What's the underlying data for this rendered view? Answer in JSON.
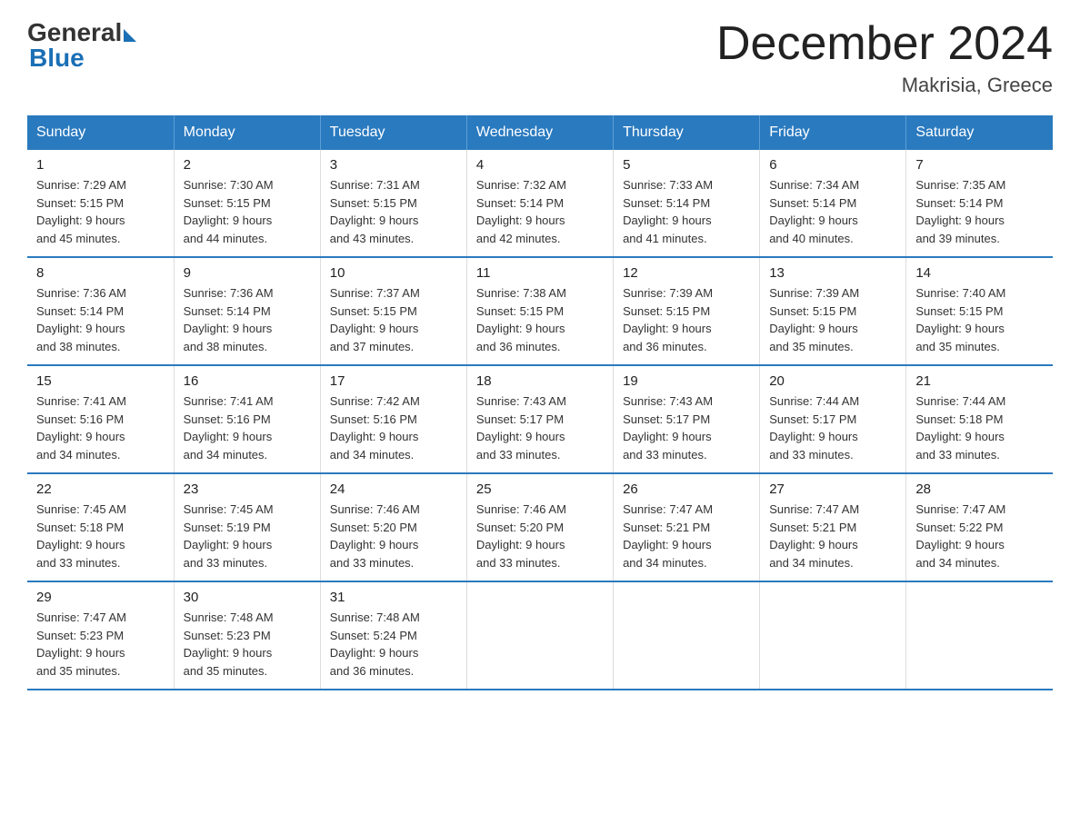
{
  "logo": {
    "general": "General",
    "blue": "Blue"
  },
  "title": "December 2024",
  "location": "Makrisia, Greece",
  "days_of_week": [
    "Sunday",
    "Monday",
    "Tuesday",
    "Wednesday",
    "Thursday",
    "Friday",
    "Saturday"
  ],
  "weeks": [
    [
      {
        "day": "1",
        "sunrise": "7:29 AM",
        "sunset": "5:15 PM",
        "daylight": "9 hours and 45 minutes."
      },
      {
        "day": "2",
        "sunrise": "7:30 AM",
        "sunset": "5:15 PM",
        "daylight": "9 hours and 44 minutes."
      },
      {
        "day": "3",
        "sunrise": "7:31 AM",
        "sunset": "5:15 PM",
        "daylight": "9 hours and 43 minutes."
      },
      {
        "day": "4",
        "sunrise": "7:32 AM",
        "sunset": "5:14 PM",
        "daylight": "9 hours and 42 minutes."
      },
      {
        "day": "5",
        "sunrise": "7:33 AM",
        "sunset": "5:14 PM",
        "daylight": "9 hours and 41 minutes."
      },
      {
        "day": "6",
        "sunrise": "7:34 AM",
        "sunset": "5:14 PM",
        "daylight": "9 hours and 40 minutes."
      },
      {
        "day": "7",
        "sunrise": "7:35 AM",
        "sunset": "5:14 PM",
        "daylight": "9 hours and 39 minutes."
      }
    ],
    [
      {
        "day": "8",
        "sunrise": "7:36 AM",
        "sunset": "5:14 PM",
        "daylight": "9 hours and 38 minutes."
      },
      {
        "day": "9",
        "sunrise": "7:36 AM",
        "sunset": "5:14 PM",
        "daylight": "9 hours and 38 minutes."
      },
      {
        "day": "10",
        "sunrise": "7:37 AM",
        "sunset": "5:15 PM",
        "daylight": "9 hours and 37 minutes."
      },
      {
        "day": "11",
        "sunrise": "7:38 AM",
        "sunset": "5:15 PM",
        "daylight": "9 hours and 36 minutes."
      },
      {
        "day": "12",
        "sunrise": "7:39 AM",
        "sunset": "5:15 PM",
        "daylight": "9 hours and 36 minutes."
      },
      {
        "day": "13",
        "sunrise": "7:39 AM",
        "sunset": "5:15 PM",
        "daylight": "9 hours and 35 minutes."
      },
      {
        "day": "14",
        "sunrise": "7:40 AM",
        "sunset": "5:15 PM",
        "daylight": "9 hours and 35 minutes."
      }
    ],
    [
      {
        "day": "15",
        "sunrise": "7:41 AM",
        "sunset": "5:16 PM",
        "daylight": "9 hours and 34 minutes."
      },
      {
        "day": "16",
        "sunrise": "7:41 AM",
        "sunset": "5:16 PM",
        "daylight": "9 hours and 34 minutes."
      },
      {
        "day": "17",
        "sunrise": "7:42 AM",
        "sunset": "5:16 PM",
        "daylight": "9 hours and 34 minutes."
      },
      {
        "day": "18",
        "sunrise": "7:43 AM",
        "sunset": "5:17 PM",
        "daylight": "9 hours and 33 minutes."
      },
      {
        "day": "19",
        "sunrise": "7:43 AM",
        "sunset": "5:17 PM",
        "daylight": "9 hours and 33 minutes."
      },
      {
        "day": "20",
        "sunrise": "7:44 AM",
        "sunset": "5:17 PM",
        "daylight": "9 hours and 33 minutes."
      },
      {
        "day": "21",
        "sunrise": "7:44 AM",
        "sunset": "5:18 PM",
        "daylight": "9 hours and 33 minutes."
      }
    ],
    [
      {
        "day": "22",
        "sunrise": "7:45 AM",
        "sunset": "5:18 PM",
        "daylight": "9 hours and 33 minutes."
      },
      {
        "day": "23",
        "sunrise": "7:45 AM",
        "sunset": "5:19 PM",
        "daylight": "9 hours and 33 minutes."
      },
      {
        "day": "24",
        "sunrise": "7:46 AM",
        "sunset": "5:20 PM",
        "daylight": "9 hours and 33 minutes."
      },
      {
        "day": "25",
        "sunrise": "7:46 AM",
        "sunset": "5:20 PM",
        "daylight": "9 hours and 33 minutes."
      },
      {
        "day": "26",
        "sunrise": "7:47 AM",
        "sunset": "5:21 PM",
        "daylight": "9 hours and 34 minutes."
      },
      {
        "day": "27",
        "sunrise": "7:47 AM",
        "sunset": "5:21 PM",
        "daylight": "9 hours and 34 minutes."
      },
      {
        "day": "28",
        "sunrise": "7:47 AM",
        "sunset": "5:22 PM",
        "daylight": "9 hours and 34 minutes."
      }
    ],
    [
      {
        "day": "29",
        "sunrise": "7:47 AM",
        "sunset": "5:23 PM",
        "daylight": "9 hours and 35 minutes."
      },
      {
        "day": "30",
        "sunrise": "7:48 AM",
        "sunset": "5:23 PM",
        "daylight": "9 hours and 35 minutes."
      },
      {
        "day": "31",
        "sunrise": "7:48 AM",
        "sunset": "5:24 PM",
        "daylight": "9 hours and 36 minutes."
      },
      null,
      null,
      null,
      null
    ]
  ],
  "labels": {
    "sunrise": "Sunrise:",
    "sunset": "Sunset:",
    "daylight": "Daylight:"
  }
}
